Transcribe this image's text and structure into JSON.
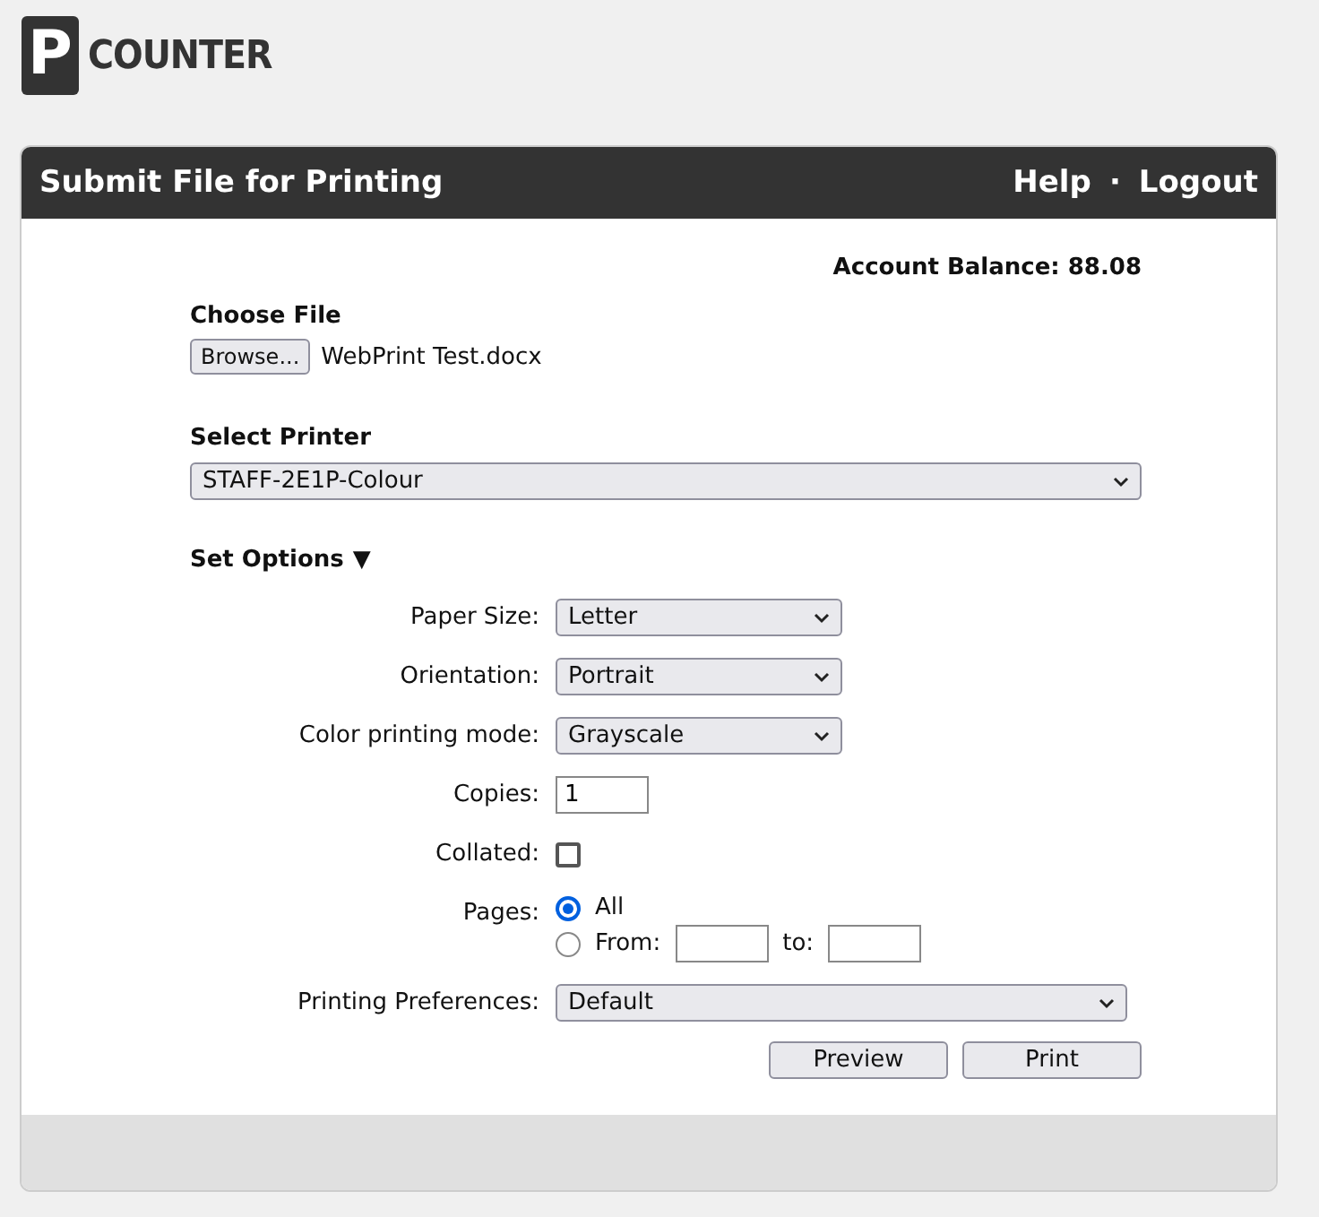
{
  "logo": {
    "letter": "P",
    "text": "COUNTER"
  },
  "header": {
    "title": "Submit File for Printing",
    "links": [
      "Help",
      "Logout"
    ],
    "separator": "·"
  },
  "account": {
    "label": "Account Balance:",
    "value": "88.08"
  },
  "file": {
    "heading": "Choose File",
    "button": "Browse...",
    "filename": "WebPrint Test.docx"
  },
  "printer": {
    "heading": "Select Printer",
    "value": "STAFF-2E1P-Colour"
  },
  "options": {
    "heading": "Set Options",
    "toggle": "▼",
    "expanded": true,
    "rows": [
      {
        "kind": "select",
        "label": "Paper Size:",
        "value": "Letter"
      },
      {
        "kind": "select",
        "label": "Orientation:",
        "value": "Portrait"
      },
      {
        "kind": "select",
        "label": "Color printing mode:",
        "value": "Grayscale"
      },
      {
        "kind": "text",
        "label": "Copies:",
        "value": "1"
      },
      {
        "kind": "checkbox",
        "label": "Collated:",
        "checked": false
      },
      {
        "kind": "pages",
        "label": "Pages:",
        "choices": [
          {
            "label": "All",
            "selected": true
          },
          {
            "label": "From:",
            "selected": false,
            "to_label": "to:"
          }
        ]
      },
      {
        "kind": "wideselect",
        "label": "Printing Preferences:",
        "value": "Default"
      }
    ]
  },
  "buttons": [
    "Preview",
    "Print"
  ]
}
